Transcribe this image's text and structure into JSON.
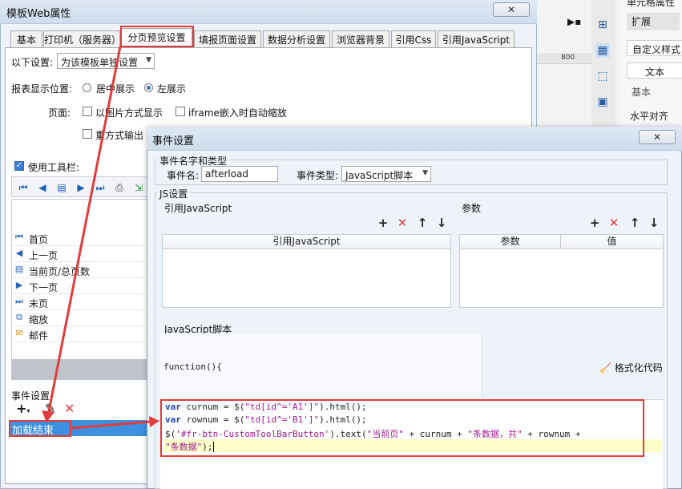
{
  "main_dialog": {
    "title": "模板Web属性",
    "close_glyph": "✕",
    "tabs": [
      "基本",
      "打印机（服务器）",
      "分页预览设置",
      "填报页面设置",
      "数据分析设置",
      "浏览器背景",
      "引用Css",
      "引用JavaScript"
    ],
    "settings_label": "以下设置:",
    "settings_value": "为该模板单独设置",
    "display_pos_label": "报表显示位置:",
    "center_label": "居中展示",
    "left_label": "左展示",
    "page_label": "页面:",
    "image_mode_label": "以图片方式显示",
    "iframe_label": "iframe嵌入时自动缩放",
    "reformat_label": "重方式输出",
    "use_toolbar_label": "使用工具栏:",
    "toolbar_items": [
      "首页",
      "上一页",
      "当前页/总页数",
      "下一页",
      "末页",
      "缩放",
      "邮件"
    ],
    "event_settings_label": "事件设置",
    "event_item": "加载结束"
  },
  "right_panel": {
    "title": "单元格属性",
    "tab_extend": "扩展",
    "custom_style": "自定义样式",
    "text_box": "文本",
    "basic_label": "基本",
    "horizontal_align": "水平对齐",
    "ruler_value": "800"
  },
  "event_dialog": {
    "title": "事件设置",
    "close_glyph": "✕",
    "name_type_group": "事件名字和类型",
    "event_name_label": "事件名:",
    "event_name_value": "afterload",
    "event_type_label": "事件类型:",
    "event_type_value": "JavaScript脚本",
    "js_settings_group": "JS设置",
    "ref_js_title": "引用JavaScript",
    "ref_js_column": "引用JavaScript",
    "params_title": "参数",
    "params_col_param": "参数",
    "params_col_value": "值",
    "js_script_title": "JavaScript脚本",
    "function_header": "function(){",
    "format_code_label": "格式化代码",
    "code": {
      "line1_kw": "var",
      "line1_rest": " curnum = $(",
      "line1_str": "\"td[id^='A1']\"",
      "line1_end": ").html();",
      "line2_kw": "var",
      "line2_rest": " rownum = $(",
      "line2_str": "\"td[id^='B1']\"",
      "line2_end": ").html();",
      "line3_pre": "$(",
      "line3_str1": "'#fr-btn-CustomToolBarButton'",
      "line3_mid": ").text(",
      "line3_str2": "\"当前页\"",
      "line3_mid2": " + curnum + ",
      "line3_str3": "\"条数据，共\"",
      "line3_end": " + rownum +",
      "line4_str": "\"条数据\"",
      "line4_end": ");"
    }
  },
  "colors": {
    "annotation_red": "#e33b3b",
    "selection_blue": "#3d8fe0",
    "code_keyword": "#1d3fb8",
    "code_string": "#a01b8f",
    "current_line": "#fefec8"
  }
}
